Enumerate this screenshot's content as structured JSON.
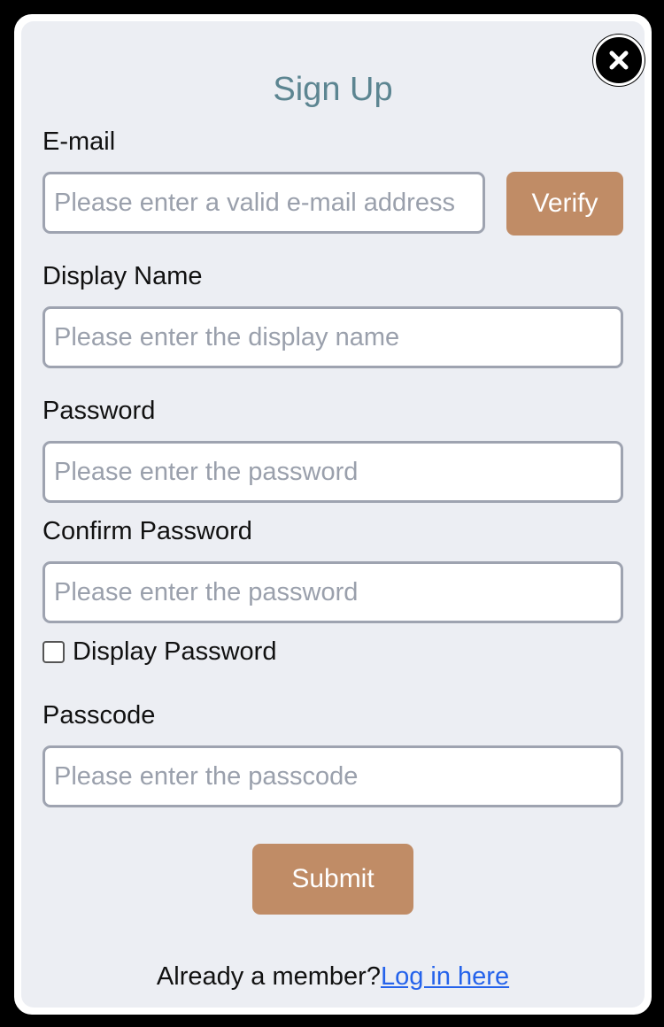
{
  "form": {
    "title": "Sign Up",
    "email": {
      "label": "E-mail",
      "placeholder": "Please enter a valid e-mail address",
      "verify_label": "Verify"
    },
    "display_name": {
      "label": "Display Name",
      "placeholder": "Please enter the display name"
    },
    "password": {
      "label": "Password",
      "placeholder": "Please enter the password"
    },
    "confirm_password": {
      "label": "Confirm Password",
      "placeholder": "Please enter the password"
    },
    "display_password": {
      "label": "Display Password",
      "checked": false
    },
    "passcode": {
      "label": "Passcode",
      "placeholder": "Please enter the passcode"
    },
    "submit_label": "Submit"
  },
  "footer": {
    "prompt": "Already a member?",
    "link_label": "Log in here"
  },
  "colors": {
    "title": "#5c8591",
    "button": "#c08c66",
    "panel": "#eceef3",
    "link": "#2563eb"
  },
  "icons": {
    "close": "close-icon"
  }
}
